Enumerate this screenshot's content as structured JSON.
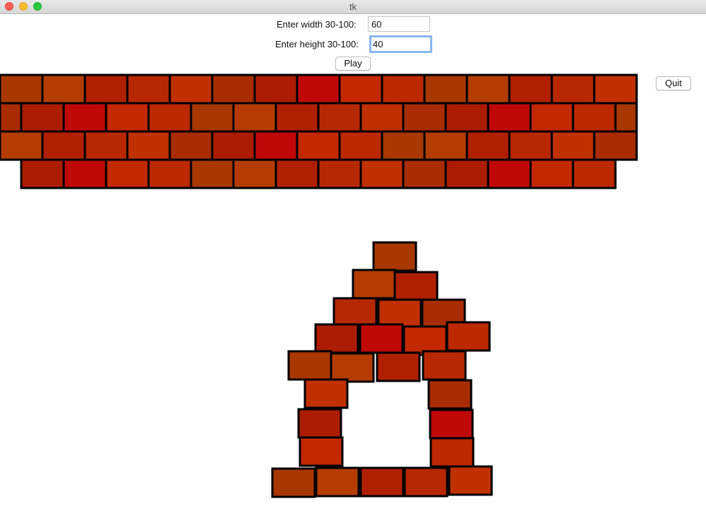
{
  "window": {
    "title": "tk"
  },
  "controls": {
    "width_label": "Enter width 30-100:",
    "width_value": "60",
    "height_label": "Enter height 30-100:",
    "height_value": "40",
    "play_label": "Play",
    "quit_label": "Quit"
  },
  "colors": {
    "brick_outline": "#000000",
    "brick_palette": [
      "#b43c00",
      "#c03000",
      "#c00808",
      "#a83800",
      "#b82800",
      "#ac1c00",
      "#bc2800",
      "#b02000",
      "#a82c00",
      "#c42800"
    ]
  }
}
